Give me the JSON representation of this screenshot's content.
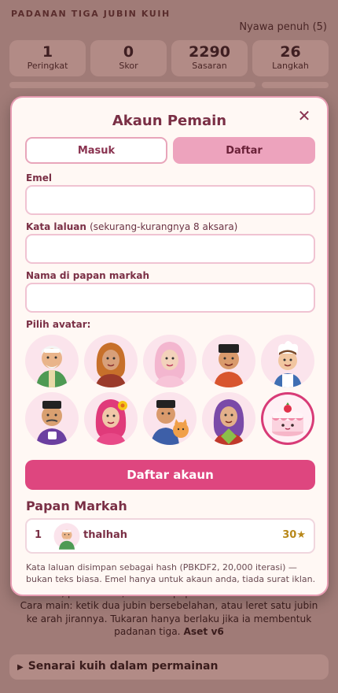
{
  "game": {
    "title": "PADANAN TIGA JUBIN KUIH",
    "lives": "Nyawa penuh (5)",
    "stats": [
      {
        "value": "1",
        "label": "Peringkat"
      },
      {
        "value": "0",
        "label": "Skor"
      },
      {
        "value": "2290",
        "label": "Sasaran"
      },
      {
        "value": "26",
        "label": "Langkah"
      }
    ],
    "howto_partial": "masuk, pilih avatar, dan lihat papan markah dalam talian.",
    "howto_text": "Cara main: ketik dua jubin bersebelahan, atau leret satu jubin ke arah jirannya. Tukaran hanya berlaku jika ia membentuk padanan tiga.",
    "asset_version": "Aset v6",
    "kuih_list_toggle": "Senarai kuih dalam permainan"
  },
  "modal": {
    "title": "Akaun Pemain",
    "close_icon": "close-icon",
    "tabs": {
      "login": "Masuk",
      "register": "Daftar",
      "active": "register"
    },
    "email_label": "Emel",
    "email_value": "",
    "password_label": "Kata laluan",
    "password_hint": "(sekurang-kurangnya 8 aksara)",
    "password_value": "",
    "display_name_label": "Nama di papan markah",
    "display_name_value": "",
    "avatar_label": "Pilih avatar:",
    "avatars": [
      {
        "name": "avatar-grandfather-icon",
        "selected": false
      },
      {
        "name": "avatar-woman-hijab-icon",
        "selected": false
      },
      {
        "name": "avatar-girl-hijab-icon",
        "selected": false
      },
      {
        "name": "avatar-boy-songkok-icon",
        "selected": false
      },
      {
        "name": "avatar-chef-boy-icon",
        "selected": false
      },
      {
        "name": "avatar-man-coffee-icon",
        "selected": false
      },
      {
        "name": "avatar-girl-flower-icon",
        "selected": false
      },
      {
        "name": "avatar-boy-cat-icon",
        "selected": false
      },
      {
        "name": "avatar-grandmother-ketupat-icon",
        "selected": false
      },
      {
        "name": "avatar-cake-icon",
        "selected": true
      }
    ],
    "submit_label": "Daftar akaun",
    "leaderboard_title": "Papan Markah",
    "leaderboard": [
      {
        "rank": "1",
        "name": "thalhah",
        "score": "30★",
        "avatar": "avatar-grandfather-icon"
      }
    ],
    "note": "Kata laluan disimpan sebagai hash (PBKDF2, 20,000 iterasi) — bukan teks biasa. Emel hanya untuk akaun anda, tiada surat iklan."
  },
  "colors": {
    "accent": "#de467f",
    "tab_active": "#eda3bd",
    "modal_bg": "#fff8f4",
    "overlay": "#a07b77",
    "score_gold": "#b8881a"
  }
}
